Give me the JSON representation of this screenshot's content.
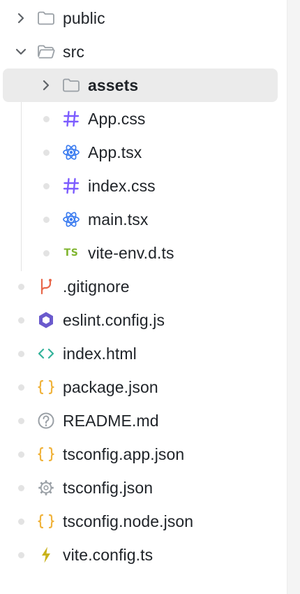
{
  "explorer": {
    "items": [
      {
        "label": "public",
        "icon": "folder-icon",
        "indent": 0,
        "kind": "folder-collapsed"
      },
      {
        "label": "src",
        "icon": "folder-open-icon",
        "indent": 0,
        "kind": "folder-expanded"
      },
      {
        "label": "assets",
        "icon": "folder-icon",
        "indent": 1,
        "kind": "folder-collapsed",
        "selected": true
      },
      {
        "label": "App.css",
        "icon": "css-hash-icon",
        "indent": 1,
        "kind": "file"
      },
      {
        "label": "App.tsx",
        "icon": "react-icon",
        "indent": 1,
        "kind": "file"
      },
      {
        "label": "index.css",
        "icon": "css-hash-icon",
        "indent": 1,
        "kind": "file"
      },
      {
        "label": "main.tsx",
        "icon": "react-icon",
        "indent": 1,
        "kind": "file"
      },
      {
        "label": "vite-env.d.ts",
        "icon": "typescript-icon",
        "icon_text": "TS",
        "indent": 1,
        "kind": "file"
      },
      {
        "label": ".gitignore",
        "icon": "git-branch-icon",
        "indent": 0,
        "kind": "file"
      },
      {
        "label": "eslint.config.js",
        "icon": "eslint-icon",
        "indent": 0,
        "kind": "file"
      },
      {
        "label": "index.html",
        "icon": "html-code-icon",
        "indent": 0,
        "kind": "file"
      },
      {
        "label": "package.json",
        "icon": "json-braces-icon",
        "indent": 0,
        "kind": "file"
      },
      {
        "label": "README.md",
        "icon": "question-circle-icon",
        "indent": 0,
        "kind": "file"
      },
      {
        "label": "tsconfig.app.json",
        "icon": "json-braces-icon",
        "indent": 0,
        "kind": "file"
      },
      {
        "label": "tsconfig.json",
        "icon": "gear-icon",
        "indent": 0,
        "kind": "file"
      },
      {
        "label": "tsconfig.node.json",
        "icon": "json-braces-icon",
        "indent": 0,
        "kind": "file"
      },
      {
        "label": "vite.config.ts",
        "icon": "lightning-bolt-icon",
        "indent": 0,
        "kind": "file"
      }
    ]
  },
  "colors": {
    "text": "#1f2328",
    "folder": "#9aa0a6",
    "chevron": "#5f6368",
    "selected_bg": "#ebebeb",
    "dot": "#e3e3e3",
    "css": "#7c5cff",
    "react": "#3b7cf0",
    "typescript": "#7fb52f",
    "git": "#e8674a",
    "eslint": "#6a5acd",
    "html": "#34b39b",
    "json": "#f0b33c",
    "readme": "#9aa0a6",
    "gear": "#9aa0a6",
    "vite": "#c9b21a"
  }
}
